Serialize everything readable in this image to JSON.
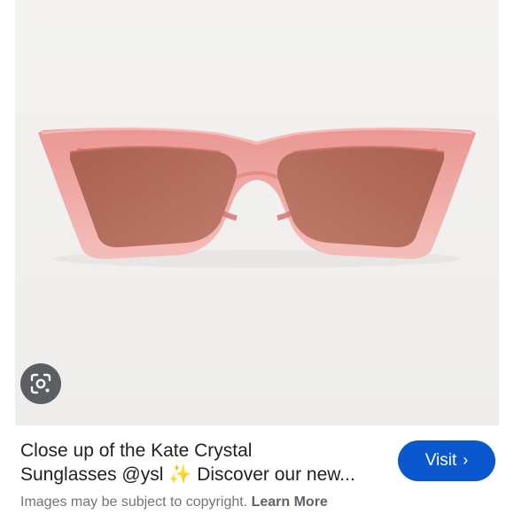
{
  "image": {
    "subject": "pink cat-eye sunglasses",
    "background_color": "#f1f0ee",
    "frame_color": "#f0a0a0",
    "lens_color": "#b86a5e"
  },
  "lens_button": {
    "icon": "google-lens-icon"
  },
  "caption": {
    "title_line1": "Close up of the Kate Crystal",
    "title_line2": "Sunglasses @ysl ✨ Discover our new...",
    "visit_label": "Visit",
    "visit_icon": "chevron-right-icon",
    "visit_color": "#0b57d0",
    "copyright_text": "Images may be subject to copyright.",
    "learn_more": "Learn More"
  }
}
